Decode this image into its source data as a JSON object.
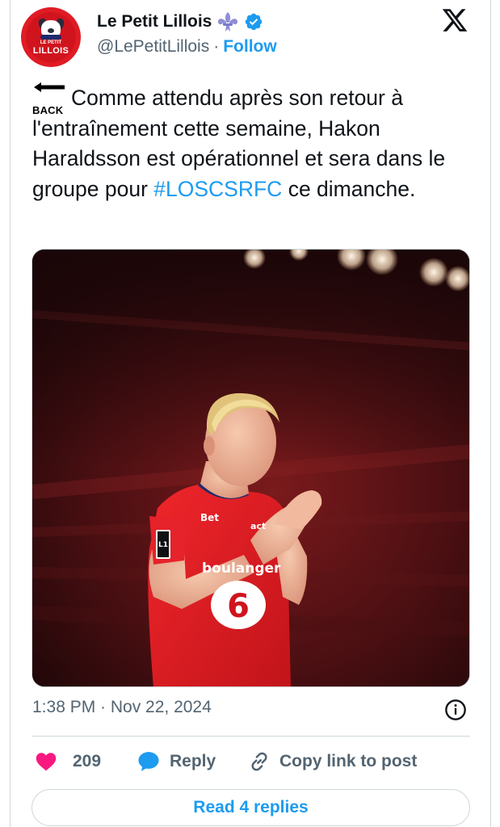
{
  "author": {
    "display_name": "Le Petit Lillois",
    "handle": "@LePetitLillois",
    "separator": "·",
    "follow_label": "Follow",
    "avatar_text": "LILLOIS",
    "avatar_small_text": "LE PETIT",
    "verified": true
  },
  "tweet": {
    "back_emoji_label": "BACK",
    "text_before": "Comme attendu après son retour à l'entraînement cette semaine, Hakon Haraldsson est opérationnel et sera dans le groupe pour ",
    "hashtag": "#LOSCSRFC",
    "text_after": " ce dimanche.",
    "jersey_texts": {
      "sponsor": "boulanger",
      "number": "6",
      "badge": "L1",
      "chest_left": "Bet",
      "chest_right": "act"
    },
    "timestamp": "1:38 PM · Nov 22, 2024"
  },
  "actions": {
    "like_count": "209",
    "reply_label": "Reply",
    "copy_label": "Copy link to post"
  },
  "read_replies_label": "Read 4 replies",
  "colors": {
    "accent": "#1d9bf0",
    "like": "#f91880",
    "muted": "#536471",
    "text": "#0f1419",
    "border": "#cfd9de"
  },
  "icons": {
    "logo": "x-logo-icon",
    "verified": "verified-badge-icon",
    "fleur": "fleur-de-lis-icon",
    "info": "info-icon",
    "like": "heart-icon",
    "reply": "speech-bubble-icon",
    "copy": "link-icon"
  }
}
